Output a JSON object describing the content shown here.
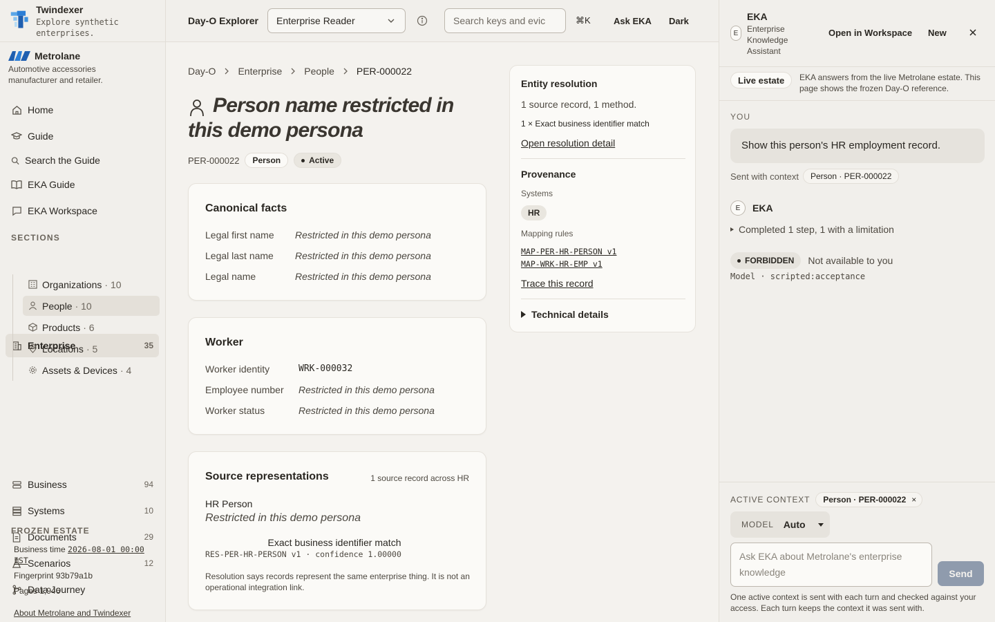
{
  "brand": {
    "name": "Twindexer",
    "tagline": "Explore synthetic enterprises."
  },
  "org": {
    "name": "Metrolane",
    "description": "Automotive accessories manufacturer and retailer."
  },
  "nav": {
    "home": "Home",
    "guide": "Guide",
    "search_guide": "Search the Guide",
    "eka_guide": "EKA Guide",
    "eka_workspace": "EKA Workspace"
  },
  "sections_label": "SECTIONS",
  "sections": [
    {
      "label": "Enterprise",
      "count": "35",
      "icon": "building-icon"
    },
    {
      "label": "Business",
      "count": "94",
      "icon": "layers-icon"
    },
    {
      "label": "Systems",
      "count": "10",
      "icon": "server-icon"
    },
    {
      "label": "Documents",
      "count": "29",
      "icon": "document-icon"
    },
    {
      "label": "Scenarios",
      "count": "12",
      "icon": "flask-icon"
    },
    {
      "label": "Data Journey",
      "count": "",
      "icon": "branch-icon"
    }
  ],
  "enterprise_children": [
    {
      "label": "Organizations",
      "count": "· 10",
      "icon": "org-icon"
    },
    {
      "label": "People",
      "count": "· 10",
      "icon": "person-icon"
    },
    {
      "label": "Products",
      "count": "· 6",
      "icon": "box-icon"
    },
    {
      "label": "Locations",
      "count": "· 5",
      "icon": "pin-icon"
    },
    {
      "label": "Assets & Devices",
      "count": "· 4",
      "icon": "cog-icon"
    }
  ],
  "frozen": {
    "label": "FROZEN ESTATE",
    "business_time_label": "Business time",
    "business_time": "2026-08-01 00:00 IST",
    "fingerprint_label": "Fingerprint",
    "fingerprint": "93b79a1b",
    "pages_label": "Pages",
    "pages": "1,946",
    "about": "About Metrolane and Twindexer"
  },
  "topbar": {
    "title": "Day-O Explorer",
    "persona": "Enterprise Reader",
    "search_placeholder": "Search keys and evic",
    "shortcut": "⌘K",
    "ask": "Ask EKA",
    "theme": "Dark"
  },
  "breadcrumb": [
    "Day-O",
    "Enterprise",
    "People",
    "PER-000022"
  ],
  "page": {
    "title": "Person name restricted in this demo persona",
    "id": "PER-000022",
    "type": "Person",
    "status": "Active"
  },
  "canonical": {
    "title": "Canonical facts",
    "rows": [
      {
        "label": "Legal first name",
        "value": "Restricted in this demo persona"
      },
      {
        "label": "Legal last name",
        "value": "Restricted in this demo persona"
      },
      {
        "label": "Legal name",
        "value": "Restricted in this demo persona"
      }
    ]
  },
  "worker": {
    "title": "Worker",
    "rows": [
      {
        "label": "Worker identity",
        "value": "WRK-000032"
      },
      {
        "label": "Employee number",
        "value": "Restricted in this demo persona"
      },
      {
        "label": "Worker status",
        "value": "Restricted in this demo persona"
      }
    ]
  },
  "sources": {
    "title": "Source representations",
    "summary": "1 source record across HR",
    "record_name": "HR Person",
    "record_value": "Restricted in this demo persona",
    "match": "Exact business identifier match",
    "match_detail": "RES-PER-HR-PERSON v1 · confidence 1.00000",
    "note": "Resolution says records represent the same enterprise thing. It is not an operational integration link."
  },
  "resolution": {
    "title": "Entity resolution",
    "summary": "1 source record, 1 method.",
    "method": "1 × Exact business identifier match",
    "link": "Open resolution detail"
  },
  "provenance": {
    "title": "Provenance",
    "systems_label": "Systems",
    "system": "HR",
    "rules_label": "Mapping rules",
    "rules": [
      "MAP-PER-HR-PERSON v1",
      "MAP-WRK-HR-EMP v1"
    ],
    "trace": "Trace this record",
    "technical": "Technical details"
  },
  "eka": {
    "avatar": "E",
    "title": "EKA",
    "subtitle": "Enterprise Knowledge Assistant",
    "open_workspace": "Open in Workspace",
    "new": "New",
    "live_label": "Live estate",
    "live_text": "EKA answers from the live Metrolane estate. This page shows the frozen Day-O reference.",
    "you_label": "YOU",
    "user_message": "Show this person's HR employment record.",
    "sent_context_label": "Sent with context",
    "sent_context": "Person · PER-000022",
    "bot_name": "EKA",
    "steps": "Completed 1 step, 1 with a limitation",
    "status": "FORBIDDEN",
    "status_text": "Not available to you",
    "model_line": "Model · scripted:acceptance",
    "active_context_label": "ACTIVE CONTEXT",
    "active_context": "Person · PER-000022",
    "model_label": "MODEL",
    "model_value": "Auto",
    "input_placeholder": "Ask EKA about Metrolane's enterprise knowledge",
    "send": "Send",
    "footnote": "One active context is sent with each turn and checked against your access. Each turn keeps the context it was sent with."
  }
}
